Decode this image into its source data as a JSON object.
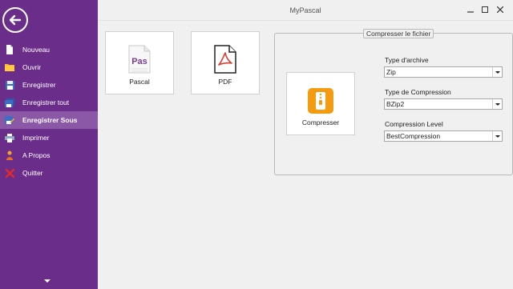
{
  "window": {
    "title": "MyPascal"
  },
  "sidebar": {
    "items": [
      {
        "label": "Nouveau",
        "icon": "new-file-icon"
      },
      {
        "label": "Ouvrir",
        "icon": "folder-icon"
      },
      {
        "label": "Enregistrer",
        "icon": "save-icon"
      },
      {
        "label": "Enregistrer tout",
        "icon": "save-all-icon"
      },
      {
        "label": "Enregistrer Sous",
        "icon": "save-as-icon",
        "active": true
      },
      {
        "label": "Imprimer",
        "icon": "printer-icon"
      },
      {
        "label": "A Propos",
        "icon": "info-icon"
      },
      {
        "label": "Quitter",
        "icon": "exit-icon"
      }
    ]
  },
  "tiles": {
    "pascal": {
      "label": "Pascal",
      "icon_text": "Pas"
    },
    "pdf": {
      "label": "PDF"
    }
  },
  "compress": {
    "group_title": "Compresser le fichier",
    "button_label": "Compresser",
    "archive_type": {
      "label": "Type d'archive",
      "value": "Zip"
    },
    "compression_type": {
      "label": "Type de Compression",
      "value": "BZip2"
    },
    "compression_level": {
      "label": "Compression Level",
      "value": "BestCompression"
    }
  },
  "colors": {
    "sidebar": "#6b2d8a",
    "active_item": "#8a58a6",
    "accent_orange": "#f39c12",
    "pdf_red": "#d63b2f"
  }
}
